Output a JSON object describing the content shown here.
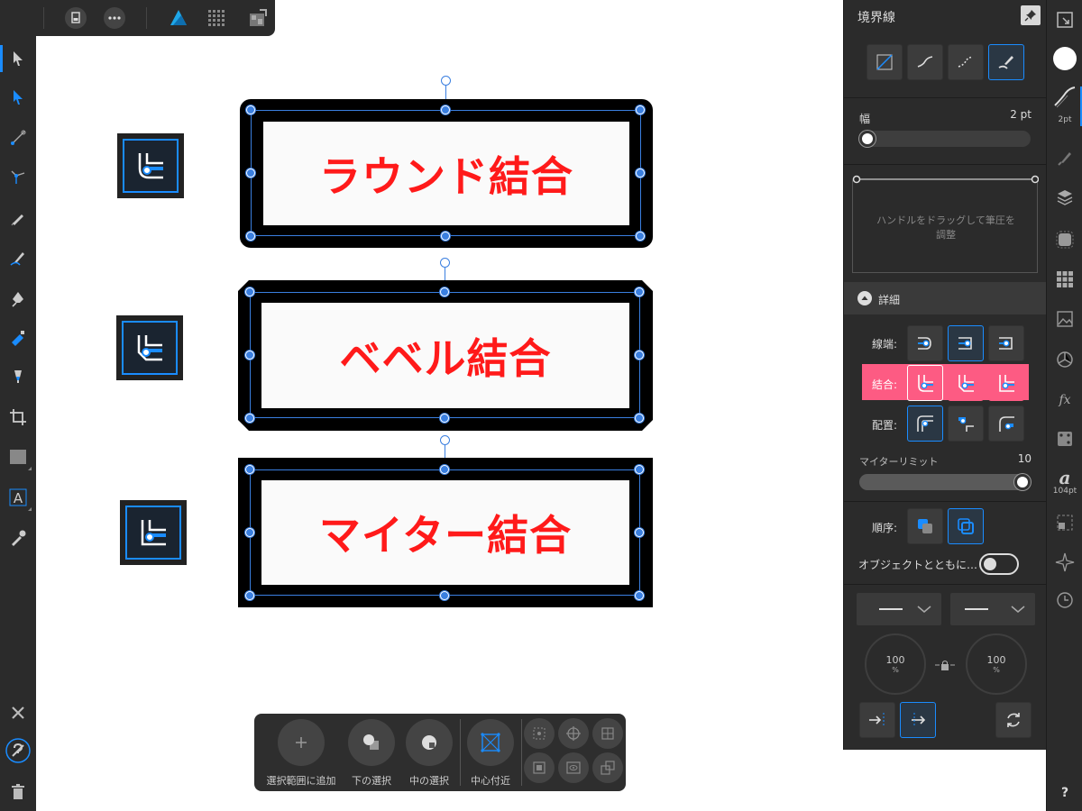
{
  "stroke_panel": {
    "title": "境界線",
    "width_label": "幅",
    "width_value": "2 pt",
    "pressure_hint_line1": "ハンドルをドラッグして筆圧を",
    "pressure_hint_line2": "調整",
    "details_label": "詳細",
    "cap_label": "線端:",
    "join_label": "結合:",
    "align_label": "配置:",
    "miter_label": "マイターリミット",
    "miter_value": "10",
    "order_label": "順序:",
    "scale_with_object_label": "オブジェクトとともに…",
    "scale_with_object_on": false,
    "start_pressure": "100",
    "end_pressure": "100",
    "percent_unit": "%",
    "accent_color": "#1a8cff",
    "join_highlight_color": "#fd5b83",
    "width_slider_fraction": 0.0,
    "miter_slider_fraction": 1.0
  },
  "canvas": {
    "shapes": [
      {
        "label": "ラウンド結合",
        "join": "round"
      },
      {
        "label": "ベベル結合",
        "join": "bevel"
      },
      {
        "label": "マイター結合",
        "join": "miter"
      }
    ],
    "text_color": "#ff1a1a",
    "selection_color": "#3a7fe0"
  },
  "context_bar": {
    "add_to_selection": "選択範囲に追加",
    "select_below": "下の選択",
    "select_inside": "中の選択",
    "near_center": "中心付近"
  },
  "right_strip": {
    "stroke_size": "2pt",
    "text_size": "104pt",
    "help": "?"
  }
}
